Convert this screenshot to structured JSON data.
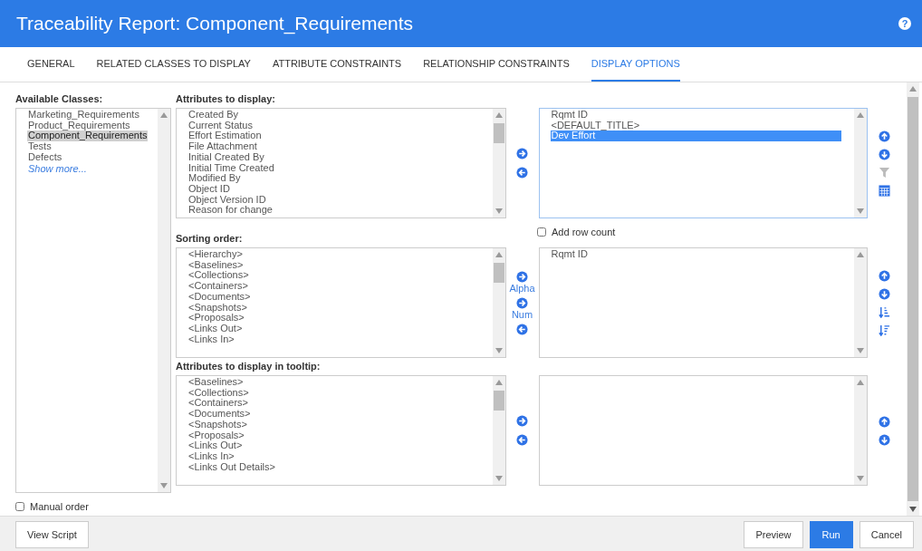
{
  "window": {
    "title": "Traceability Report: Component_Requirements",
    "help": "?"
  },
  "tabs": [
    {
      "label": "GENERAL",
      "selected": false
    },
    {
      "label": "RELATED CLASSES TO DISPLAY",
      "selected": false
    },
    {
      "label": "ATTRIBUTE CONSTRAINTS",
      "selected": false
    },
    {
      "label": "RELATIONSHIP CONSTRAINTS",
      "selected": false
    },
    {
      "label": "DISPLAY OPTIONS",
      "selected": true
    }
  ],
  "available_classes": {
    "label": "Available Classes:",
    "items": [
      {
        "text": "Marketing_Requirements",
        "selected": false
      },
      {
        "text": "Product_Requirements",
        "selected": false
      },
      {
        "text": "Component_Requirements",
        "selected": true
      },
      {
        "text": "Tests",
        "selected": false
      },
      {
        "text": "Defects",
        "selected": false
      }
    ],
    "show_more": "Show more..."
  },
  "attributes": {
    "label": "Attributes to display:",
    "available": [
      "Created By",
      "Current Status",
      "Effort Estimation",
      "File Attachment",
      "Initial Created By",
      "Initial Time Created",
      "Modified By",
      "Object ID",
      "Object Version ID",
      "Reason for change"
    ],
    "chosen": [
      {
        "text": "Rqmt ID",
        "selected": false
      },
      {
        "text": "<DEFAULT_TITLE>",
        "selected": false
      },
      {
        "text": "Dev Effort",
        "selected": true
      }
    ],
    "add_row_count": {
      "label": "Add row count",
      "checked": false
    }
  },
  "sorting": {
    "label": "Sorting order:",
    "available": [
      "<Hierarchy>",
      "<Baselines>",
      "<Collections>",
      "<Containers>",
      "<Documents>",
      "<Snapshots>",
      "<Proposals>",
      "<Links Out>",
      "<Links In>"
    ],
    "alpha_label": "Alpha",
    "num_label": "Num",
    "chosen": [
      {
        "text": "Rqmt ID",
        "selected": false
      }
    ]
  },
  "tooltip": {
    "label": "Attributes to display in tooltip:",
    "available": [
      "<Baselines>",
      "<Collections>",
      "<Containers>",
      "<Documents>",
      "<Snapshots>",
      "<Proposals>",
      "<Links Out>",
      "<Links In>",
      "<Links Out Details>"
    ]
  },
  "manual_order": {
    "label": "Manual order",
    "checked": false
  },
  "footer": {
    "view_script": "View Script",
    "preview": "Preview",
    "run": "Run",
    "cancel": "Cancel"
  }
}
